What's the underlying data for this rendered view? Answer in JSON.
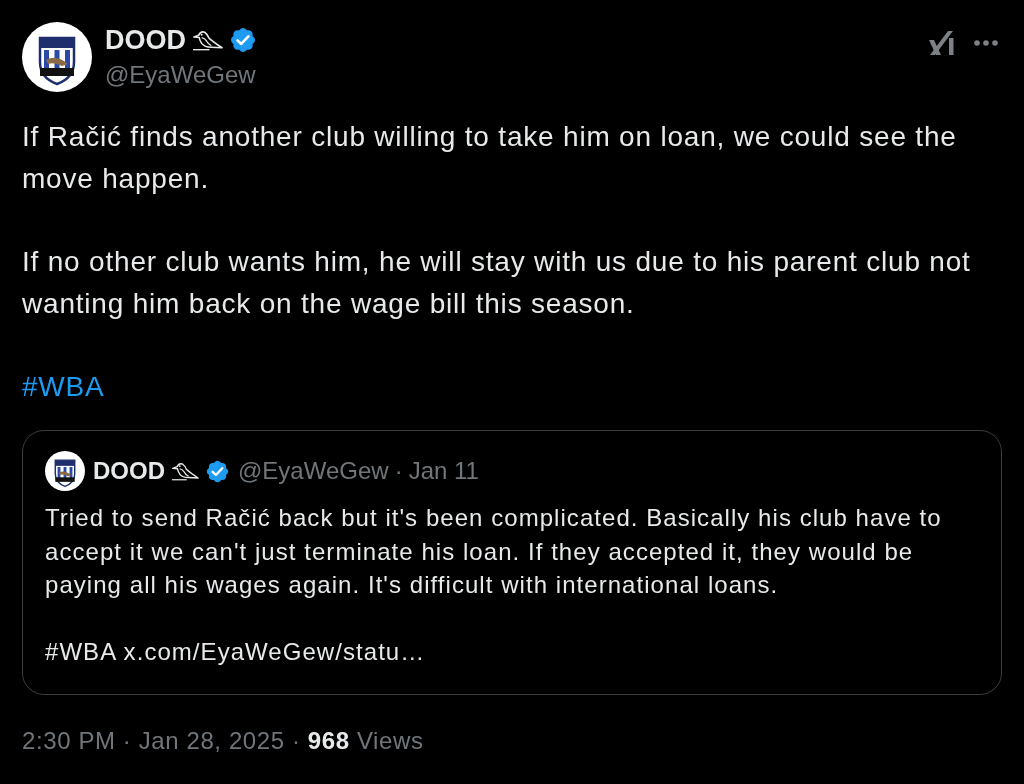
{
  "post": {
    "author": {
      "name": "DOOD",
      "handle": "@EyaWeGew",
      "verified": true
    },
    "body": [
      "If Račić finds another club willing to take him on loan, we could see the move happen.",
      "If no other club wants him, he will stay with us due to his parent club not wanting him back on the wage bill this season."
    ],
    "hashtag": "#WBA",
    "quoted_post": {
      "author": {
        "name": "DOOD",
        "handle": "@EyaWeGew",
        "verified": true
      },
      "separator": "·",
      "date": "Jan 11",
      "body": [
        "Tried to send Račić back but it's been complicated. Basically his club have to accept it we can't just terminate his loan. If they accepted it, they would be paying all his wages again. It's difficult with international loans.",
        "#WBA x.com/EyaWeGew/statu…"
      ]
    },
    "meta": "2:30 PM · Jan 28, 2025 · **968** Views"
  }
}
